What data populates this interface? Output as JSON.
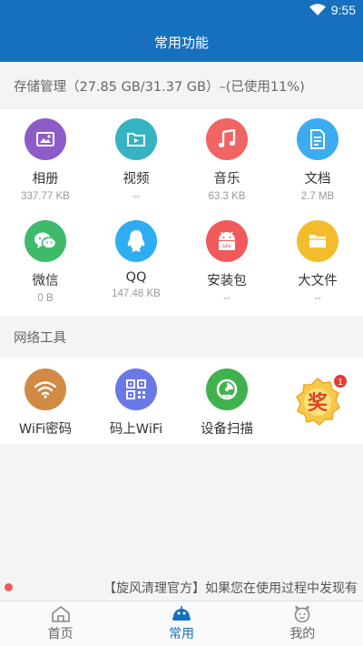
{
  "status_bar": {
    "time": "9:55"
  },
  "app_bar": {
    "title": "常用功能"
  },
  "storage": {
    "header": "存储管理（27.85 GB/31.37 GB）–(已使用11%)"
  },
  "storage_items": [
    {
      "label": "相册",
      "sub": "337.77 KB",
      "icon": "photo-album-icon",
      "color": "#8e5cc9"
    },
    {
      "label": "视频",
      "sub": "--",
      "icon": "video-folder-icon",
      "color": "#36b3c3"
    },
    {
      "label": "音乐",
      "sub": "63.3 KB",
      "icon": "music-note-icon",
      "color": "#f06464"
    },
    {
      "label": "文档",
      "sub": "2.7 MB",
      "icon": "document-icon",
      "color": "#3cacf0"
    },
    {
      "label": "微信",
      "sub": "0 B",
      "icon": "wechat-icon",
      "color": "#3fba6b"
    },
    {
      "label": "QQ",
      "sub": "147.48 KB",
      "icon": "qq-penguin-icon",
      "color": "#2eaef0"
    },
    {
      "label": "安装包",
      "sub": "--",
      "icon": "apk-android-icon",
      "color": "#f05a5a"
    },
    {
      "label": "大文件",
      "sub": "--",
      "icon": "folder-icon",
      "color": "#f2bc2d"
    }
  ],
  "network": {
    "header": "网络工具",
    "items": [
      {
        "label": "WiFi密码",
        "icon": "wifi-icon",
        "color": "#d18a44"
      },
      {
        "label": "码上WiFi",
        "icon": "qr-code-icon",
        "color": "#6a78e6"
      },
      {
        "label": "设备扫描",
        "icon": "device-scan-icon",
        "color": "#3fb24e"
      }
    ]
  },
  "reward": {
    "badge": "1",
    "char": "奖",
    "icon": "reward-prize-icon"
  },
  "marquee": {
    "text": "【旋风清理官方】如果您在使用过程中发现有"
  },
  "bottom_nav": [
    {
      "label": "首页",
      "icon": "home-icon"
    },
    {
      "label": "常用",
      "icon": "robot-icon",
      "active": true
    },
    {
      "label": "我的",
      "icon": "profile-face-icon"
    }
  ]
}
